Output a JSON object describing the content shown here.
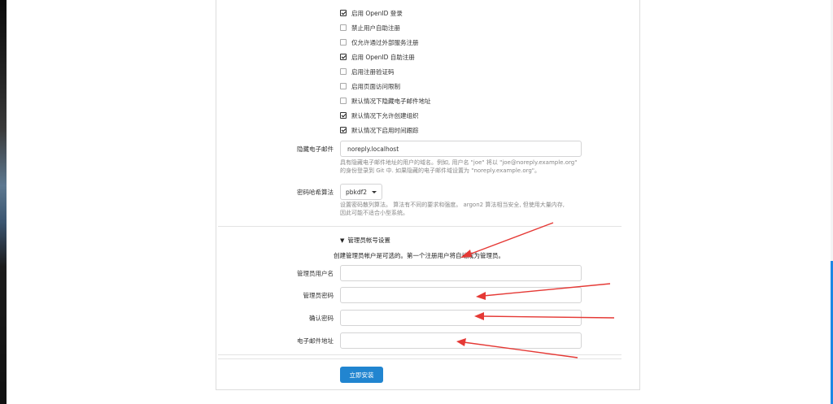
{
  "checkboxes": [
    {
      "label": "启用 OpenID 登录",
      "checked": true
    },
    {
      "label": "禁止用户自助注册",
      "checked": false
    },
    {
      "label": "仅允许通过外部服务注册",
      "checked": false
    },
    {
      "label": "启用 OpenID 自助注册",
      "checked": true
    },
    {
      "label": "启用注册验证码",
      "checked": false
    },
    {
      "label": "启用页面访问限制",
      "checked": false
    },
    {
      "label": "默认情况下隐藏电子邮件地址",
      "checked": false
    },
    {
      "label": "默认情况下允许创建组织",
      "checked": true
    },
    {
      "label": "默认情况下启用时间跟踪",
      "checked": true
    }
  ],
  "hidden_email": {
    "label": "隐藏电子邮件",
    "value": "noreply.localhost",
    "help_line1": "具有隐藏电子邮件地址的用户的域名。例如, 用户名 \"joe\" 将以 \"joe@noreply.example.org\"",
    "help_line2": "的身份登录到 Git 中. 如果隐藏的电子邮件域设置为 \"noreply.example.org\"。"
  },
  "password_hash": {
    "label": "密码哈希算法",
    "value": "pbkdf2",
    "help_line1": "设置密码散列算法。 算法有不同的要求和强度。 argon2 算法相当安全, 但使用大量内存,",
    "help_line2": "因此可能不适合小型系统。"
  },
  "admin_section": {
    "title": "管理员帐号设置",
    "description": "创建管理员帐户是可选的。第一个注册用户将自动成为管理员。",
    "username_label": "管理员用户名",
    "password_label": "管理员密码",
    "confirm_label": "确认密码",
    "email_label": "电子邮件地址",
    "username_value": "",
    "password_value": "",
    "confirm_value": "",
    "email_value": ""
  },
  "install_button": "立即安装",
  "colors": {
    "accent": "#2185d0",
    "annotation": "#e53935"
  }
}
